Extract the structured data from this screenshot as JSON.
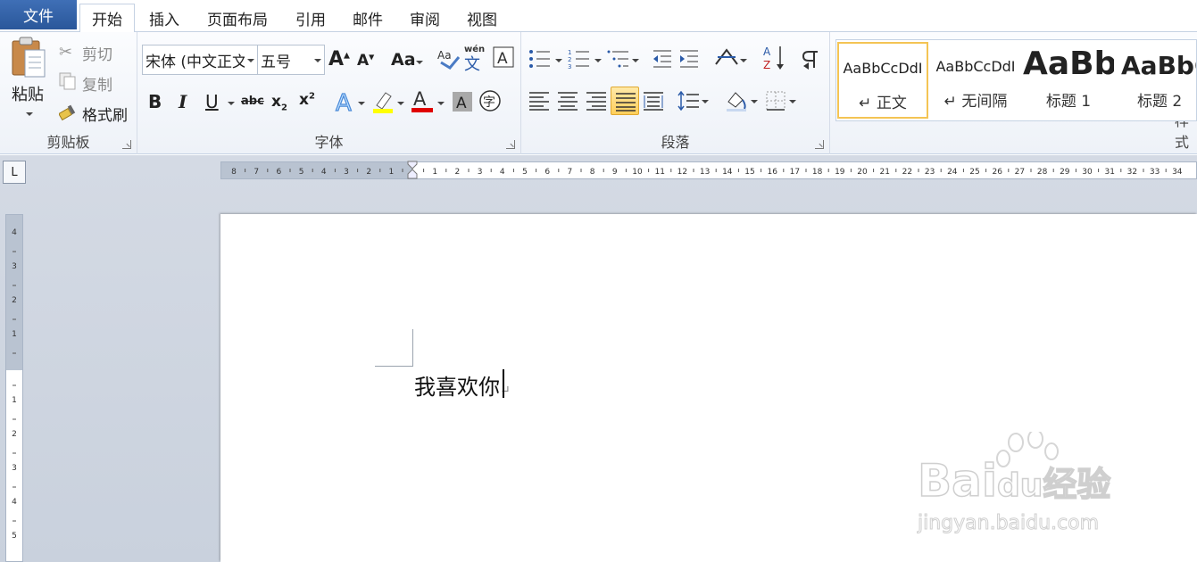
{
  "tabs": {
    "file": "文件",
    "items": [
      "开始",
      "插入",
      "页面布局",
      "引用",
      "邮件",
      "审阅",
      "视图"
    ],
    "active": "开始"
  },
  "clipboard": {
    "paste": "粘贴",
    "cut": "剪切",
    "copy": "复制",
    "format_painter": "格式刷",
    "group": "剪贴板"
  },
  "font": {
    "name": "宋体 (中文正文",
    "size": "五号",
    "group": "字体",
    "bold": "B",
    "italic": "I",
    "underline": "U",
    "strike": "abc",
    "change_case": "Aa"
  },
  "paragraph": {
    "group": "段落"
  },
  "styles": {
    "group": "样式",
    "items": [
      {
        "sample": "AaBbCcDdI",
        "name": "↵ 正文"
      },
      {
        "sample": "AaBbCcDdI",
        "name": "↵ 无间隔"
      },
      {
        "sample": "AaBb",
        "name": "标题 1"
      },
      {
        "sample": "AaBbC",
        "name": "标题 2"
      }
    ]
  },
  "ruler": {
    "corner": "L",
    "left_ticks": [
      "8",
      "7",
      "6",
      "5",
      "4",
      "3",
      "2",
      "1"
    ],
    "right_ticks": [
      "1",
      "2",
      "3",
      "4",
      "5",
      "6",
      "7",
      "8",
      "9",
      "10",
      "11",
      "12",
      "13",
      "14",
      "15",
      "16",
      "17",
      "18",
      "19",
      "20",
      "21",
      "22",
      "23",
      "24",
      "25",
      "26",
      "27",
      "28",
      "29",
      "30",
      "31",
      "32",
      "33",
      "34"
    ],
    "v_top_ticks": [
      "4",
      "3",
      "2",
      "1"
    ],
    "v_bottom_ticks": [
      "1",
      "2",
      "3",
      "4",
      "5"
    ]
  },
  "document": {
    "text": "我喜欢你",
    "para_mark": "↵"
  },
  "watermark": {
    "brand": "Bai",
    "brand2": "du",
    "cn": "经验",
    "url": "jingyan.baidu.com"
  },
  "colors": {
    "file_tab": "#2a579a",
    "highlight": "#ffff00",
    "font_color": "#e00000",
    "selected_style": "#f4c454"
  }
}
